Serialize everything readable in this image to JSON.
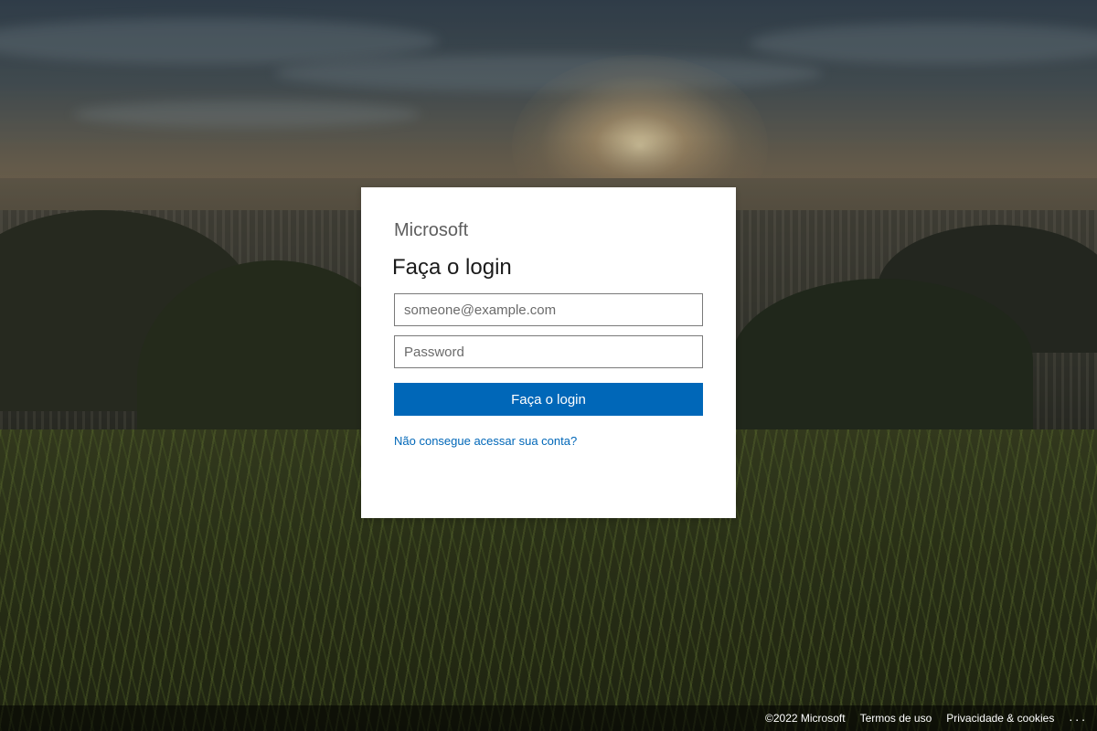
{
  "brand": {
    "name": "Microsoft"
  },
  "login": {
    "title": "Faça o login",
    "email_placeholder": "someone@example.com",
    "email_value": "",
    "password_placeholder": "Password",
    "password_value": "",
    "submit_label": "Faça o login",
    "help_link": "Não consegue acessar sua conta?"
  },
  "footer": {
    "copyright": "©2022 Microsoft",
    "terms": "Termos de uso",
    "privacy": "Privacidade & cookies",
    "more": "..."
  },
  "colors": {
    "accent": "#0067b8",
    "card_bg": "#ffffff",
    "brand_text": "#5e5e5e"
  },
  "icons": {
    "more": "ellipsis-icon"
  }
}
